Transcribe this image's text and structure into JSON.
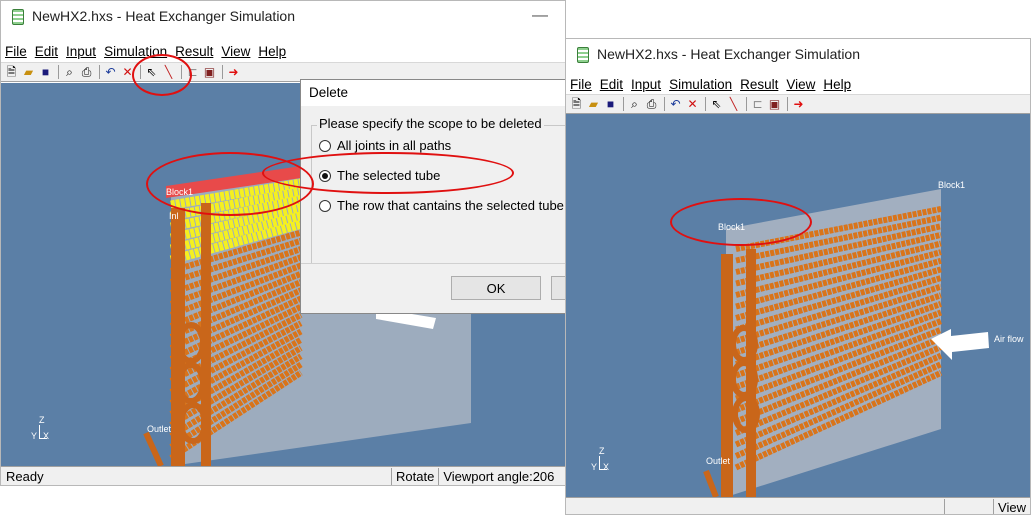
{
  "left_window": {
    "title": "NewHX2.hxs - Heat Exchanger Simulation",
    "menu": [
      "File",
      "Edit",
      "Input",
      "Simulation",
      "Result",
      "View",
      "Help"
    ],
    "status_ready": "Ready",
    "status_mode": "Rotate",
    "status_viewport": "Viewport angle:206",
    "block_label": "Block1",
    "block_sub_label": "Inl",
    "outlet_label": "Outlet",
    "axis_z": "Z",
    "axis_x": "X",
    "axis_y": "Y"
  },
  "right_window": {
    "title": "NewHX2.hxs - Heat Exchanger Simulation",
    "menu": [
      "File",
      "Edit",
      "Input",
      "Simulation",
      "Result",
      "View",
      "Help"
    ],
    "block_label_top": "Block1",
    "block_label_front": "Block1",
    "airflow_label": "Air flow",
    "outlet_label": "Outlet",
    "axis_z": "Z",
    "axis_x": "X",
    "axis_y": "Y",
    "status_view": "View"
  },
  "delete_dialog": {
    "title": "Delete",
    "group_label": "Please specify the scope to be deleted",
    "options": [
      "All joints in all paths",
      "The selected tube",
      "The row that cantains the selected tube"
    ],
    "selected_index": 1,
    "ok_label": "OK"
  },
  "colors": {
    "viewport_bg": "#5b7fa6",
    "tube_orange": "#d9741a",
    "highlight_yellow": "#f5f020",
    "annotation_red": "#e01010"
  }
}
